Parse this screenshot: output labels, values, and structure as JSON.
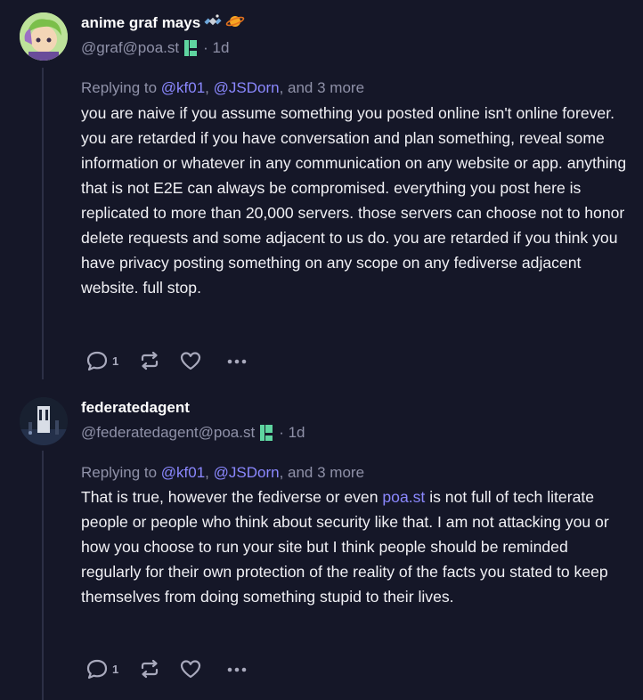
{
  "posts": [
    {
      "display_name": "anime graf mays",
      "emoji": [
        "satellite-emoji",
        "ringed-planet-emoji"
      ],
      "handle": "@graf@poa.st",
      "time": "· 1d",
      "reply_prefix": "Replying to ",
      "mentions": [
        "@kf01",
        "@JSDorn"
      ],
      "reply_sep": ", ",
      "reply_more": ", and 3 more",
      "body": "you are naive if you assume something you posted online isn't online forever. you are retarded if you have conversation and plan something, reveal some information or whatever in any communication on any website or app. anything that is not E2E can always be compromised. everything you post here is replicated to more than 20,000 servers. those servers can choose not to honor delete requests and some adjacent to us do. you are retarded if you think you have privacy posting something on any scope on any fediverse adjacent website. full stop.",
      "reply_count": "1"
    },
    {
      "display_name": "federatedagent",
      "handle": "@federatedagent@poa.st",
      "time": "· 1d",
      "reply_prefix": "Replying to ",
      "mentions": [
        "@kf01",
        "@JSDorn"
      ],
      "reply_sep": ", ",
      "reply_more": ", and 3 more",
      "body_before_link": "That is true, however the fediverse or even ",
      "body_link": "poa.st",
      "body_after_link": " is not full of tech literate people or people who think about security like that. I am not attacking you or how you choose to run your site but I think people should be reminded regularly for their own protection of the reality of the facts you stated to keep themselves from doing something stupid to their lives.",
      "reply_count": "1"
    }
  ],
  "colors": {
    "background": "#151728",
    "text": "#f1f1f5",
    "muted": "#8f91a8",
    "mention": "#8b88ff",
    "badge": "#5fd5a0"
  }
}
